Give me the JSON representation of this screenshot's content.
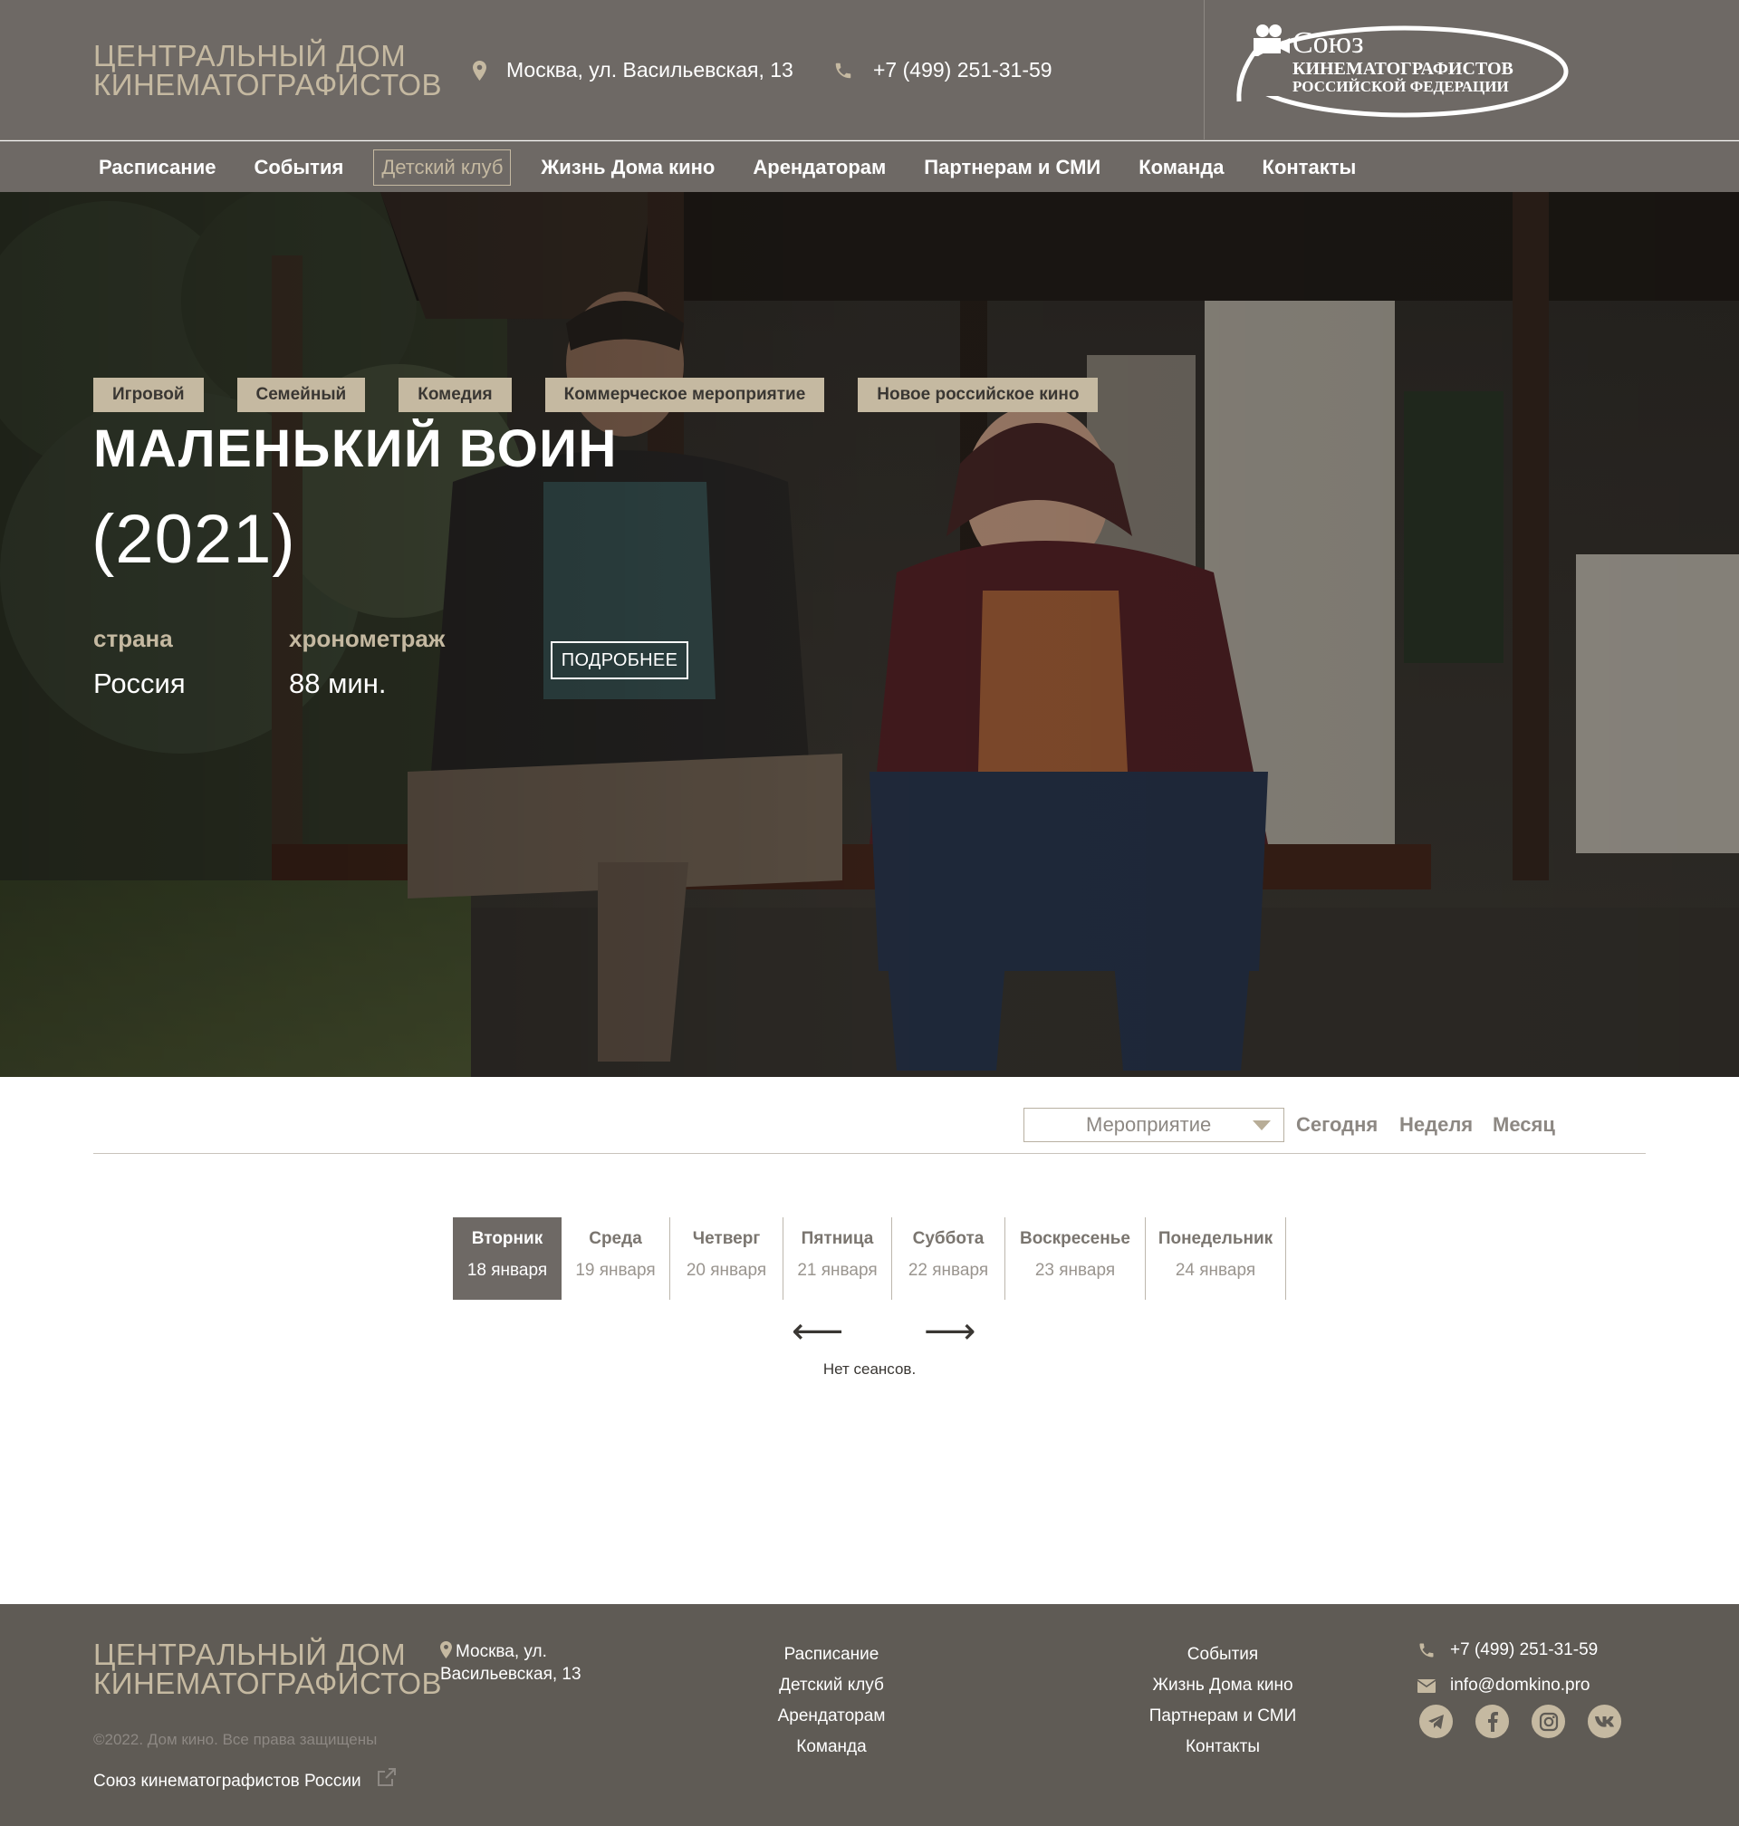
{
  "header": {
    "brand_line1": "ЦЕНТРАЛЬНЫЙ ДОМ",
    "brand_line2": "КИНЕМАТОГРАФИСТОВ",
    "address": "Москва, ул. Васильевская, 13",
    "phone": "+7 (499) 251-31-59",
    "union_logo": {
      "line1": "Союз",
      "line2": "КИНЕМАТОГРАФИСТОВ",
      "line3": "РОССИЙСКОЙ ФЕДЕРАЦИИ"
    }
  },
  "nav": {
    "items": [
      {
        "label": "Расписание"
      },
      {
        "label": "События"
      },
      {
        "label": "Детский клуб",
        "active": true
      },
      {
        "label": "Жизнь Дома кино"
      },
      {
        "label": "Арендаторам"
      },
      {
        "label": "Партнерам и СМИ"
      },
      {
        "label": "Команда"
      },
      {
        "label": "Контакты"
      }
    ]
  },
  "hero": {
    "tags": [
      "Игровой",
      "Семейный",
      "Комедия",
      "Коммерческое мероприятие",
      "Новое российское кино"
    ],
    "title": "МАЛЕНЬКИЙ ВОИН",
    "year": "(2021)",
    "country_label": "страна",
    "country": "Россия",
    "duration_label": "хронометраж",
    "duration": "88 мин.",
    "more_button": "ПОДРОБНЕЕ"
  },
  "filters": {
    "select_value": "Мероприятие",
    "periods": [
      "Сегодня",
      "Неделя",
      "Месяц"
    ]
  },
  "days": [
    {
      "name": "Вторник",
      "date": "18 января",
      "active": true
    },
    {
      "name": "Среда",
      "date": "19 января"
    },
    {
      "name": "Четверг",
      "date": "20 января"
    },
    {
      "name": "Пятница",
      "date": "21 января"
    },
    {
      "name": "Суббота",
      "date": "22 января"
    },
    {
      "name": "Воскресенье",
      "date": "23 января"
    },
    {
      "name": "Понедельник",
      "date": "24 января"
    }
  ],
  "day_nav": {
    "prev": "⟵",
    "next": "⟶"
  },
  "no_sessions": "Нет сеансов.",
  "footer": {
    "brand_line1": "ЦЕНТРАЛЬНЫЙ ДОМ",
    "brand_line2": "КИНЕМАТОГРАФИСТОВ",
    "address_line1": "Москва, ул.",
    "address_line2": "Васильевская, 13",
    "copyright": "©2022. Дом кино. Все права защищены",
    "union_link": "Союз кинематографистов России",
    "col1": [
      "Расписание",
      "Детский клуб",
      "Арендаторам",
      "Команда"
    ],
    "col2": [
      "События",
      "Жизнь Дома кино",
      "Партнерам и СМИ",
      "Контакты"
    ],
    "phone": "+7 (499) 251-31-59",
    "email": "info@domkino.pro",
    "social": [
      "telegram-icon",
      "facebook-icon",
      "instagram-icon",
      "vk-icon"
    ]
  },
  "colors": {
    "header_bg": "#6e6965",
    "accent": "#c5b9a1",
    "footer_bg": "#5f5b55"
  }
}
